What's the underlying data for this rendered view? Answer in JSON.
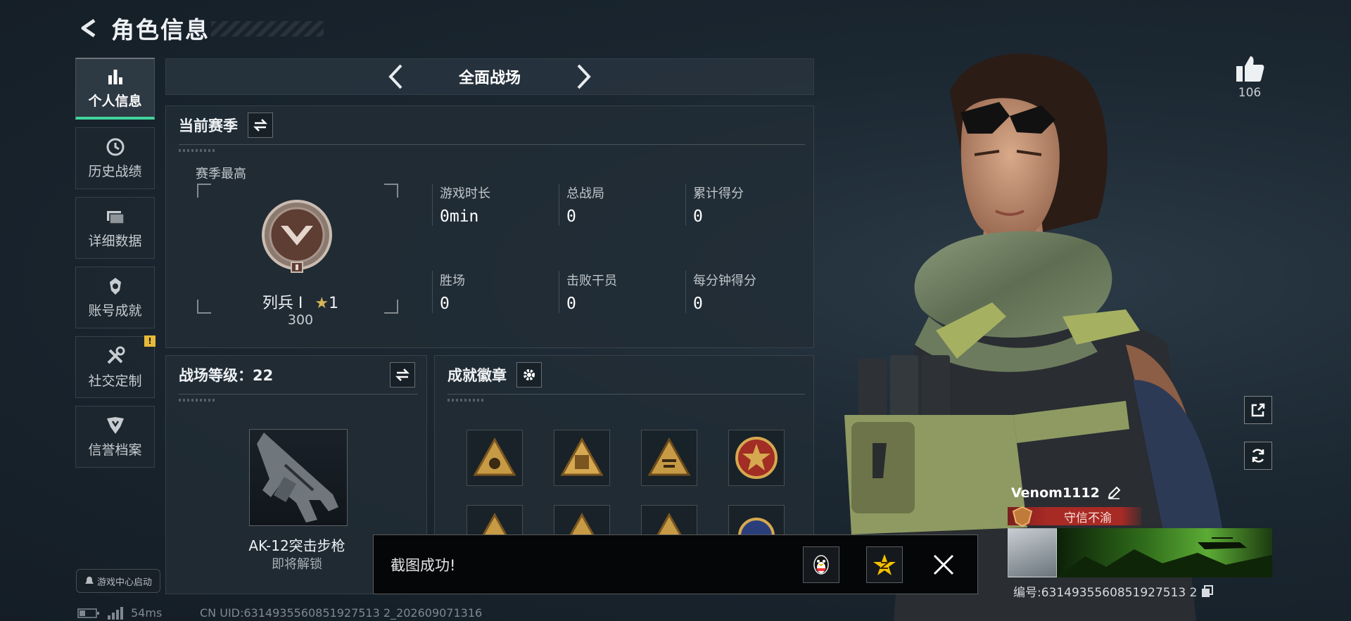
{
  "header": {
    "title": "角色信息"
  },
  "sidebar": {
    "items": [
      {
        "label": "个人信息",
        "icon": "bar-chart-icon",
        "active": true
      },
      {
        "label": "历史战绩",
        "icon": "clock-icon"
      },
      {
        "label": "详细数据",
        "icon": "folder-icon"
      },
      {
        "label": "账号成就",
        "icon": "medal-icon"
      },
      {
        "label": "社交定制",
        "icon": "tools-icon",
        "badge": "!"
      },
      {
        "label": "信誉档案",
        "icon": "shield-emblem-icon"
      }
    ],
    "launch_label": "游戏中心启动"
  },
  "mode": {
    "title": "全面战场"
  },
  "season": {
    "title": "当前赛季",
    "best_label": "赛季最高",
    "rank_name": "列兵 I",
    "rank_stars": "1",
    "rank_score": "300",
    "stats": [
      {
        "label": "游戏时长",
        "value": "0min"
      },
      {
        "label": "总战局",
        "value": "0"
      },
      {
        "label": "累计得分",
        "value": "0"
      },
      {
        "label": "胜场",
        "value": "0"
      },
      {
        "label": "击败干员",
        "value": "0"
      },
      {
        "label": "每分钟得分",
        "value": "0"
      }
    ]
  },
  "level": {
    "title": "战场等级：22",
    "weapon_name": "AK-12突击步枪",
    "weapon_status": "即将解锁"
  },
  "badges": {
    "title": "成就徽章"
  },
  "toast": {
    "text": "截图成功!"
  },
  "status": {
    "ping": "54ms",
    "uid": "CN UID:6314935560851927513 2_202609071316"
  },
  "profile": {
    "likes": "106",
    "name": "Venom1112",
    "title": "守信不渝",
    "id_text": "编号:6314935560851927513 2"
  },
  "colors": {
    "accent": "#41d49b",
    "title_red": "#a82a25",
    "badge_gold": "#c79a45"
  }
}
